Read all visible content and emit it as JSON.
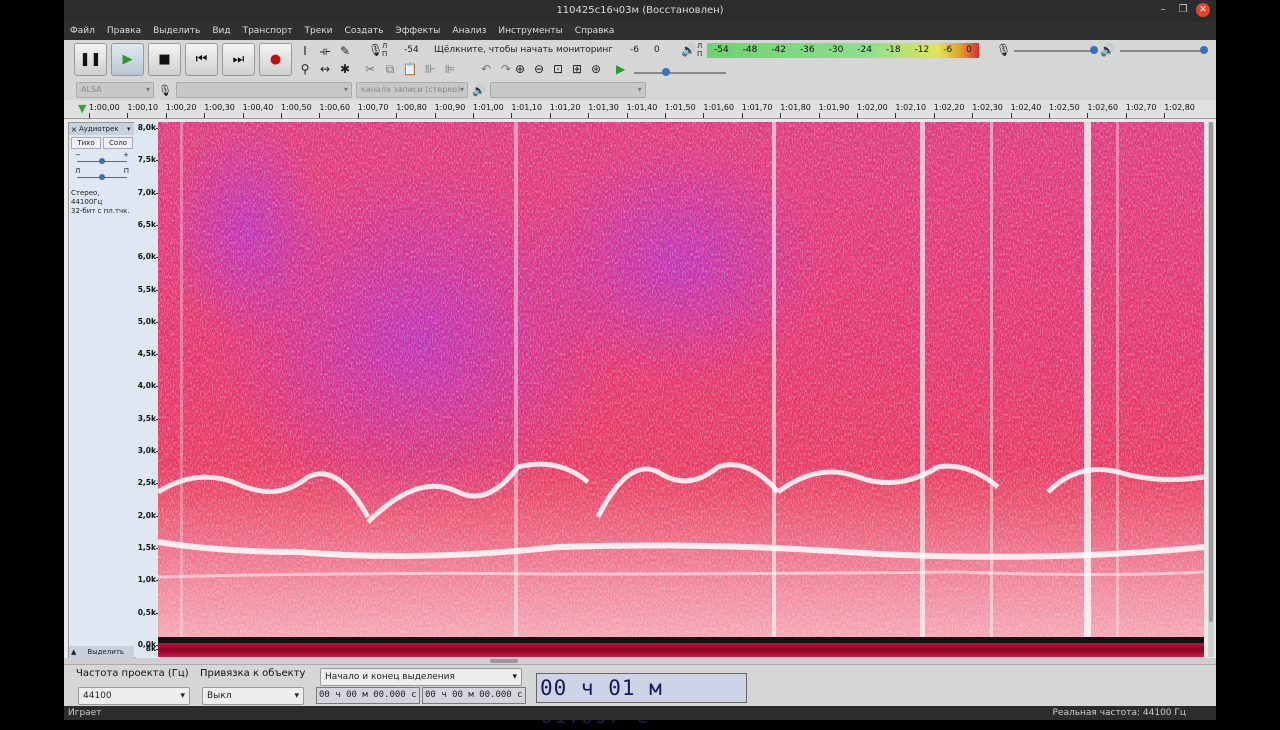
{
  "window": {
    "title": "110425c16ч03м (Восстановлен)"
  },
  "menu": [
    "Файл",
    "Правка",
    "Выделить",
    "Вид",
    "Транспорт",
    "Треки",
    "Создать",
    "Эффекты",
    "Анализ",
    "Инструменты",
    "Справка"
  ],
  "transport": {
    "pause_icon": "pause-icon",
    "play_icon": "play-icon",
    "stop_icon": "stop-icon",
    "skip_start_icon": "skip-start-icon",
    "skip_end_icon": "skip-end-icon",
    "record_icon": "record-icon"
  },
  "recording_meter": {
    "lr_top": "Л",
    "lr_bottom": "П",
    "db_left": "-54",
    "message": "Щёлкните, чтобы начать мониторинг",
    "db_right1": "-6",
    "db_right2": "0"
  },
  "playback_meter": {
    "lr_top": "Л",
    "lr_bottom": "П",
    "ticks": [
      "-54",
      "-48",
      "-42",
      "-36",
      "-30",
      "-24",
      "-18",
      "-12",
      "-6",
      "0"
    ],
    "colors": {
      "green": "#6fd16f",
      "yellow": "#e3e35a",
      "red": "#d93030"
    }
  },
  "device_bar": {
    "host": "ALSA",
    "input_channels": "канала записи (стерео)"
  },
  "ruler": {
    "labels": [
      "1:00,00",
      "1:00,10",
      "1:00,20",
      "1:00,30",
      "1:00,40",
      "1:00,50",
      "1:00,60",
      "1:00,70",
      "1:00,80",
      "1:00,90",
      "1:01,00",
      "1:01,10",
      "1:01,20",
      "1:01,30",
      "1:01,40",
      "1:01,50",
      "1:01,60",
      "1:01,70",
      "1:01,80",
      "1:01,90",
      "1:02,00",
      "1:02,10",
      "1:02,20",
      "1:02,30",
      "1:02,40",
      "1:02,50",
      "1:02,60",
      "1:02,70",
      "1:02,80"
    ]
  },
  "track": {
    "close_label": "×",
    "name": "Аудиотрек",
    "mute_label": "Тихо",
    "solo_label": "Соло",
    "gain_minus": "−",
    "gain_plus": "+",
    "pan_left": "Л",
    "pan_right": "П",
    "info_line1": "Стерео, 44100Гц",
    "info_line2": "32-бит с пл.тчк.",
    "select_label": "Выделить"
  },
  "freq_axis": [
    "8,0k",
    "7,5k",
    "7,0k",
    "6,5k",
    "6,0k",
    "5,5k",
    "5,0k",
    "4,5k",
    "4,0k",
    "3,5k",
    "3,0k",
    "2,5k",
    "2,0k",
    "1,5k",
    "1,0k",
    "0,5k",
    "0,0k",
    "8k"
  ],
  "selection_toolbar": {
    "project_rate_label": "Частота проекта (Гц)",
    "project_rate_value": "44100",
    "snap_label": "Привязка к объекту",
    "snap_value": "Выкл",
    "selection_mode": "Начало и конец выделения",
    "start_time": "00 ч 00 м 00.000 с",
    "end_time": "00 ч 00 м 00.000 с"
  },
  "audio_position": "00 ч 01 м 01.097 с",
  "status": {
    "left": "Играет",
    "right": "Реальная частота: 44100 Гц"
  }
}
